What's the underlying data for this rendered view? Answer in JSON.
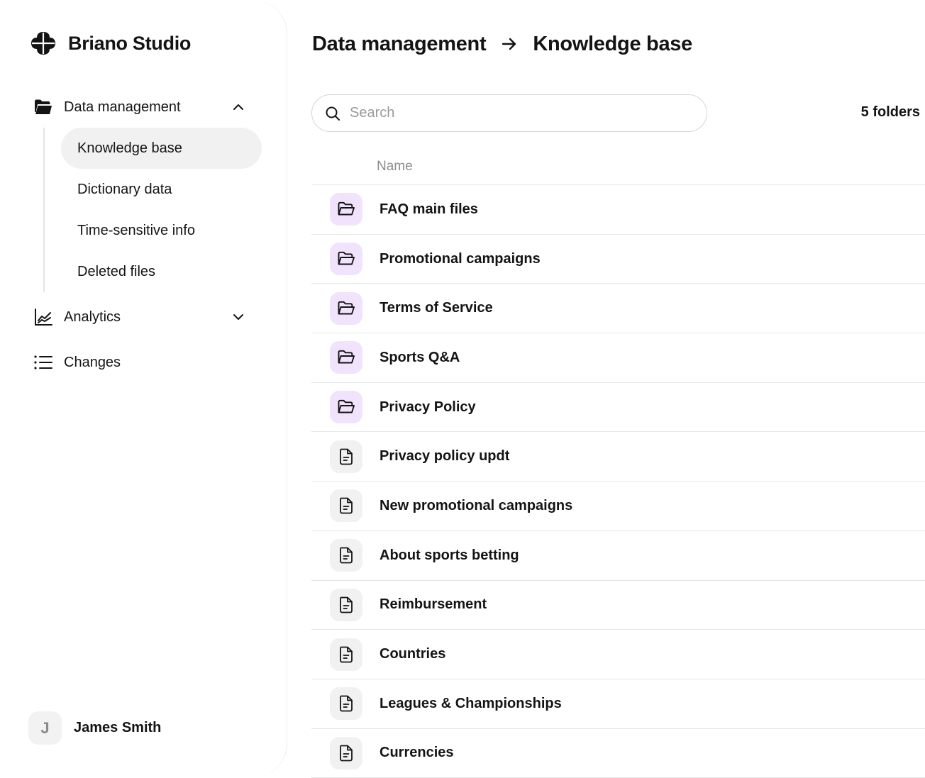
{
  "app": {
    "name": "Briano Studio"
  },
  "sidebar": {
    "groups": [
      {
        "label": "Data management",
        "icon": "folder-icon",
        "expanded": true
      },
      {
        "label": "Analytics",
        "icon": "chart-icon",
        "expanded": false
      },
      {
        "label": "Changes",
        "icon": "list-icon"
      }
    ],
    "subitems": [
      {
        "label": "Knowledge base",
        "active": true
      },
      {
        "label": "Dictionary data"
      },
      {
        "label": "Time-sensitive info"
      },
      {
        "label": "Deleted files"
      }
    ],
    "user": {
      "initial": "J",
      "name": "James Smith"
    }
  },
  "breadcrumb": {
    "parent": "Data management",
    "current": "Knowledge base"
  },
  "search": {
    "placeholder": "Search",
    "value": ""
  },
  "summary": {
    "count_label": "5 folders"
  },
  "table": {
    "column_name": "Name",
    "rows": [
      {
        "type": "folder",
        "label": "FAQ main files"
      },
      {
        "type": "folder",
        "label": "Promotional campaigns"
      },
      {
        "type": "folder",
        "label": "Terms of Service"
      },
      {
        "type": "folder",
        "label": "Sports Q&A"
      },
      {
        "type": "folder",
        "label": "Privacy Policy"
      },
      {
        "type": "file",
        "label": "Privacy policy updt"
      },
      {
        "type": "file",
        "label": "New promotional campaigns"
      },
      {
        "type": "file",
        "label": "About sports betting"
      },
      {
        "type": "file",
        "label": "Reimbursement"
      },
      {
        "type": "file",
        "label": "Countries"
      },
      {
        "type": "file",
        "label": "Leagues & Championships"
      },
      {
        "type": "file",
        "label": "Currencies"
      }
    ]
  },
  "colors": {
    "text": "#141414",
    "muted": "#8e8e8e",
    "folder_icon_bg": "#f1e3fb",
    "file_icon_bg": "#f1f1f1",
    "active_nav_bg": "#f1f1f1",
    "divider": "#e6e6e6"
  }
}
